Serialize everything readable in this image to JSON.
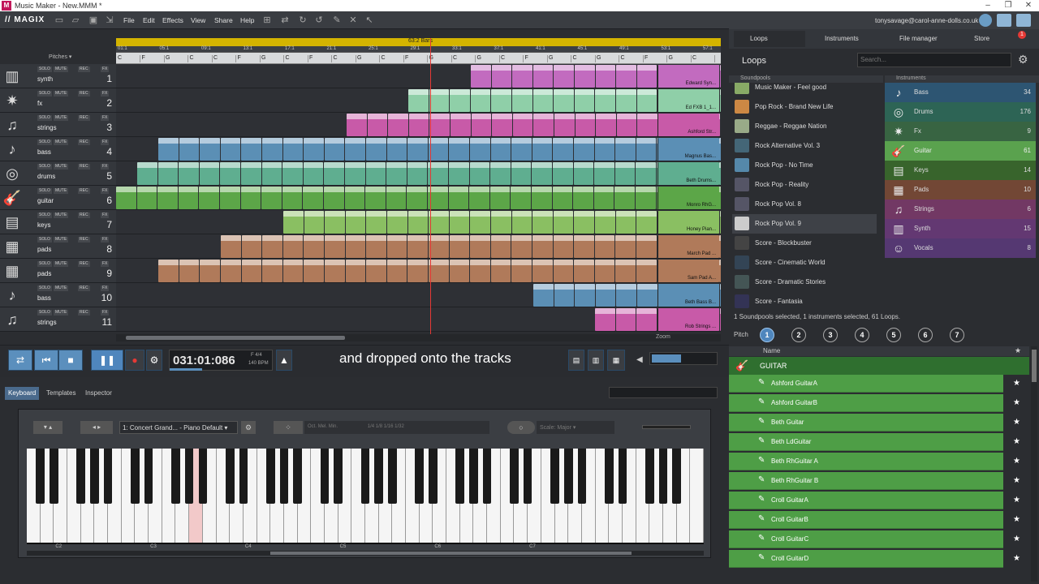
{
  "titlebar": {
    "title": "Music Maker - New.MMM *"
  },
  "menu": {
    "brand": "// MAGIX",
    "items": [
      "File",
      "Edit",
      "Effects",
      "View",
      "Share",
      "Help"
    ]
  },
  "account": {
    "email": "tonysavage@carol-anne-dolls.co.uk"
  },
  "arranger": {
    "ruler_label": "63:2 Bars",
    "pitches_label": "Pitches",
    "bars": [
      "01:1",
      "05:1",
      "09:1",
      "13:1",
      "17:1",
      "21:1",
      "25:1",
      "29:1",
      "33:1",
      "37:1",
      "41:1",
      "45:1",
      "49:1",
      "53:1",
      "57:1"
    ],
    "chords": [
      "C",
      "F",
      "G",
      "C",
      "C",
      "F",
      "G",
      "C",
      "F",
      "C",
      "G",
      "C",
      "F",
      "G",
      "C",
      "G",
      "C",
      "F",
      "G",
      "C",
      "G",
      "C",
      "F",
      "G",
      "C"
    ],
    "zoom_label": "Zoom",
    "tracks": [
      {
        "name": "synth",
        "num": "1",
        "icon": "synth-icon"
      },
      {
        "name": "fx",
        "num": "2",
        "icon": "fx-icon"
      },
      {
        "name": "strings",
        "num": "3",
        "icon": "strings-icon"
      },
      {
        "name": "bass",
        "num": "4",
        "icon": "bass-icon"
      },
      {
        "name": "drums",
        "num": "5",
        "icon": "drums-icon"
      },
      {
        "name": "guitar",
        "num": "6",
        "icon": "guitar-icon"
      },
      {
        "name": "keys",
        "num": "7",
        "icon": "keys-icon"
      },
      {
        "name": "pads",
        "num": "8",
        "icon": "pads-icon"
      },
      {
        "name": "pads",
        "num": "9",
        "icon": "pads-icon"
      },
      {
        "name": "bass",
        "num": "10",
        "icon": "bass-icon"
      },
      {
        "name": "strings",
        "num": "11",
        "icon": "strings-icon"
      }
    ],
    "track_buttons": {
      "solo": "SOLO",
      "mute": "MUTE",
      "rec": "REC",
      "fx": "FX"
    },
    "clip_labels": [
      "Edward Syn...",
      "Ed FXB 1_1...",
      "Ashford Str...",
      "Magnus Bas...",
      "Beth Drums...",
      "Monro RhG...",
      "Honey Pian...",
      "March Pad ...",
      "Sam Pad A...",
      "Beth Bass B...",
      "Rob Strings ..."
    ],
    "clip_short": {
      "drums": "Bet...",
      "guitar_start": "Mo..."
    }
  },
  "transport": {
    "time": "031:01:086",
    "tempo_top": "F   4/4",
    "tempo_bottom": "140 BPM"
  },
  "caption": "and dropped onto the tracks",
  "keyboard_panel": {
    "tabs": [
      "Keyboard",
      "Templates",
      "Inspector"
    ],
    "instrument": "1: Concert Grand... - Piano Default",
    "scale": "Scale: Major",
    "octave_labels": [
      "Oct.",
      "Mel.",
      "Min."
    ],
    "note_values": [
      "1/4",
      "1/8",
      "1/16",
      "1/32"
    ],
    "key_labels": [
      "C2",
      "C3",
      "C4",
      "C5",
      "C6",
      "C7"
    ]
  },
  "right_panel": {
    "tabs": [
      "Loops",
      "Instruments",
      "File manager",
      "Store"
    ],
    "store_badge": "1",
    "title": "Loops",
    "search_placeholder": "Search...",
    "col_soundpools": "Soundpools",
    "col_instruments": "Instruments",
    "soundpools": [
      "Music Maker - Feel good",
      "Pop Rock - Brand New Life",
      "Reggae - Reggae Nation",
      "Rock Alternative Vol. 3",
      "Rock Pop - No Time",
      "Rock Pop - Reality",
      "Rock Pop Vol. 8",
      "Rock Pop Vol. 9",
      "Score - Blockbuster",
      "Score - Cinematic World",
      "Score - Dramatic Stories",
      "Score - Fantasia"
    ],
    "instruments": [
      {
        "name": "Bass",
        "count": "34",
        "color": "#2e5a7a",
        "icon": "bass-icon"
      },
      {
        "name": "Drums",
        "count": "176",
        "color": "#2e6a5a",
        "icon": "drums-icon"
      },
      {
        "name": "Fx",
        "count": "9",
        "color": "#3a6a44",
        "icon": "fx-icon"
      },
      {
        "name": "Guitar",
        "count": "61",
        "color": "#5aa24e",
        "icon": "guitar-icon"
      },
      {
        "name": "Keys",
        "count": "14",
        "color": "#3a6a2c",
        "icon": "keys-icon"
      },
      {
        "name": "Pads",
        "count": "10",
        "color": "#7a4a36",
        "icon": "pads-icon"
      },
      {
        "name": "Strings",
        "count": "6",
        "color": "#7a3a6a",
        "icon": "strings-icon"
      },
      {
        "name": "Synth",
        "count": "15",
        "color": "#6a3a7a",
        "icon": "synth-icon"
      },
      {
        "name": "Vocals",
        "count": "8",
        "color": "#5a3a7a",
        "icon": "vocals-icon"
      }
    ],
    "status": "1 Soundpools selected, 1 instruments selected, 61 Loops.",
    "pitch_label": "Pitch",
    "pitches": [
      "1",
      "2",
      "3",
      "4",
      "5",
      "6",
      "7"
    ],
    "name_col": "Name",
    "group_header": "GUITAR",
    "loops": [
      "Ashford GuitarA",
      "Ashford GuitarB",
      "Beth Guitar",
      "Beth LdGuitar",
      "Beth RhGuitar A",
      "Beth RhGuitar B",
      "Croll GuitarA",
      "Croll GuitarB",
      "Croll GuitarC",
      "Croll GuitarD"
    ]
  },
  "colors": {
    "synth": "#c26bbf",
    "fx": "#8fcfa8",
    "strings": "#c85aa8",
    "bass": "#5b8fb5",
    "drums": "#5fae90",
    "guitar": "#5ca648",
    "keys": "#8abf62",
    "pads": "#b07a5a",
    "accent": "#5aa24e"
  }
}
